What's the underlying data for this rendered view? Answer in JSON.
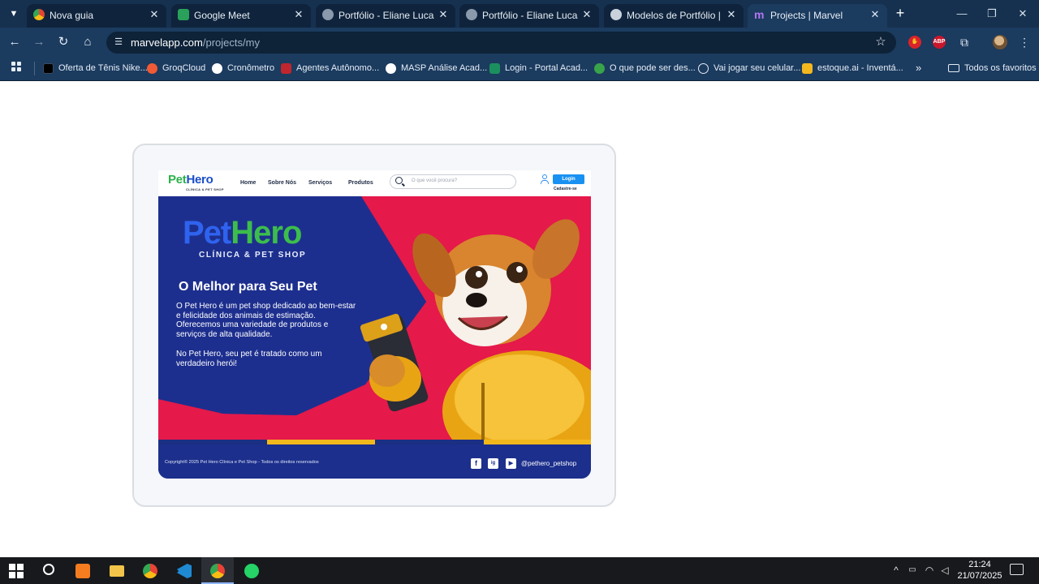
{
  "browser": {
    "tabs": [
      {
        "title": "Nova guia",
        "favicon": "chrome-icon",
        "color": "#ffffff",
        "active": false
      },
      {
        "title": "Google Meet",
        "favicon": "google-meet-icon",
        "color": "#2aa15a",
        "active": false
      },
      {
        "title": "Portfólio - Eliane Lucas",
        "favicon": "globe-icon",
        "color": "#8a99ab",
        "active": false
      },
      {
        "title": "Portfólio - Eliane Lucas",
        "favicon": "globe-icon",
        "color": "#8a99ab",
        "active": false
      },
      {
        "title": "Modelos de Portfólio | Visme",
        "favicon": "visme-icon",
        "color": "#c9d2dc",
        "active": false
      },
      {
        "title": "Projects | Marvel",
        "favicon": "marvel-icon",
        "color": "#b374f0",
        "active": true
      }
    ],
    "url": {
      "domain": "marvelapp.com",
      "path": "/projects/my"
    },
    "extensions": [
      {
        "name": "adblock-icon",
        "color": "#d9232a",
        "label": ""
      },
      {
        "name": "abp-icon",
        "color": "#c8172c",
        "label": "ABP"
      }
    ],
    "bookmarks": [
      {
        "label": "Oferta de Tênis Nike...",
        "icon": "nike-icon",
        "color": "#000000"
      },
      {
        "label": "GroqCloud",
        "icon": "groq-icon",
        "color": "#f25a36"
      },
      {
        "label": "Cronômetro",
        "icon": "stopwatch-icon",
        "color": "#ffffff"
      },
      {
        "label": "Agentes Autônomo...",
        "icon": "agent-icon",
        "color": "#c0262e"
      },
      {
        "label": "MASP Análise Acad...",
        "icon": "masp-icon",
        "color": "#ffffff"
      },
      {
        "label": "Login - Portal Acad...",
        "icon": "portal-icon",
        "color": "#1c8f5e"
      },
      {
        "label": "O que pode ser des...",
        "icon": "leaf-icon",
        "color": "#39a34a"
      },
      {
        "label": "Vai jogar seu celular...",
        "icon": "target-icon",
        "color": "#e6edf6"
      },
      {
        "label": "estoque.ai - Inventá...",
        "icon": "estoque-icon",
        "color": "#f5b71e"
      }
    ],
    "bookmarks_folder": "Todos os favoritos"
  },
  "mockup": {
    "nav": {
      "logo_a": "Pet",
      "logo_b": "Hero",
      "logo_sub": "CLÍNICA & PET SHOP",
      "links": [
        "Home",
        "Sobre Nós",
        "Serviços",
        "Produtos"
      ],
      "search_placeholder": "O que você procura?",
      "login": "Login",
      "signup": "Cadastre-se"
    },
    "hero": {
      "brand_a": "Pet",
      "brand_b": "Hero",
      "brand_sub": "CLÍNICA & PET SHOP",
      "headline": "O Melhor para Seu Pet",
      "paragraph1": "O Pet Hero é um pet shop dedicado ao bem-estar e felicidade dos animais de estimação. Oferecemos uma variedade de produtos e serviços de alta qualidade.",
      "paragraph2": "No Pet Hero, seu pet é tratado como um verdadeiro herói!"
    },
    "footer": {
      "copyright": "Copyright© 2025 Pet Hero Clínica e Pet Shop - Todos os direitos reservados",
      "social": [
        "f",
        "ig",
        "▶"
      ],
      "handle": "@pethero_petshop"
    },
    "colors": {
      "navy": "#1d2f8e",
      "crimson": "#e5194a",
      "gold": "#f2b71b",
      "green": "#3cbd4c",
      "blue": "#2f63ef"
    }
  },
  "taskbar": {
    "apps": [
      "windows-start-icon",
      "search-icon",
      "xampp-icon",
      "file-explorer-icon",
      "chrome-icon",
      "vscode-icon",
      "chrome-profile-icon",
      "whatsapp-icon"
    ],
    "time": "21:24",
    "date": "21/07/2025"
  }
}
